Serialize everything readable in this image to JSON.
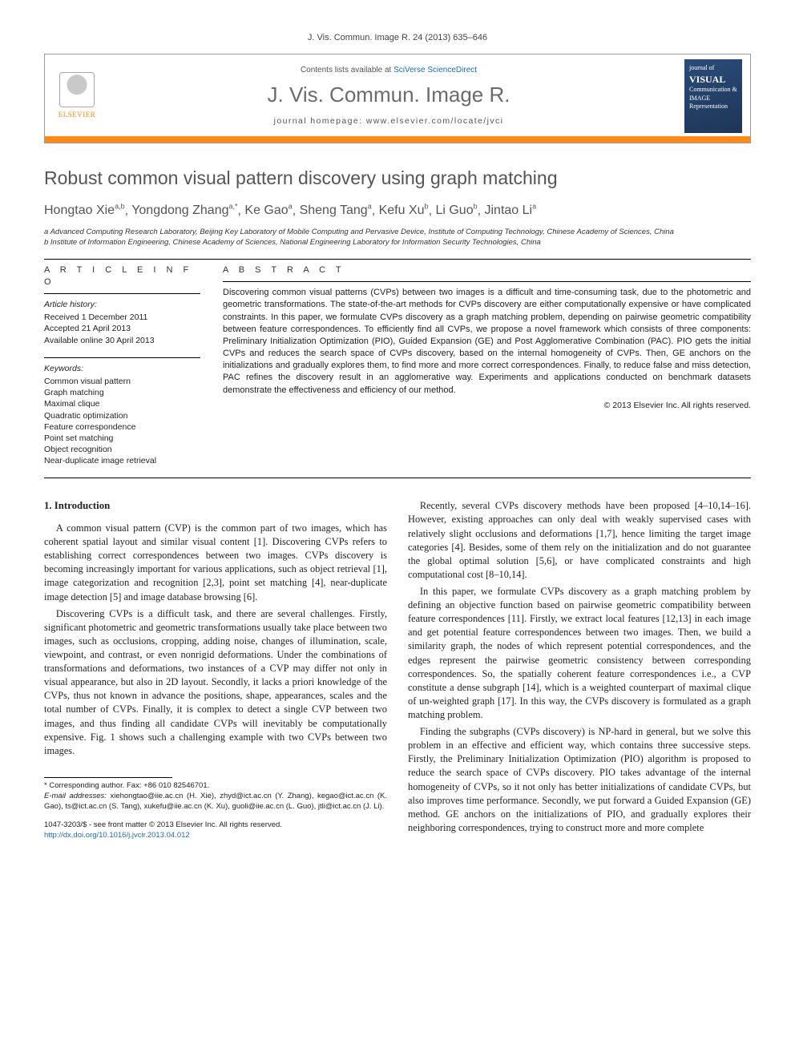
{
  "running_head": "J. Vis. Commun. Image R. 24 (2013) 635–646",
  "header": {
    "contents_prefix": "Contents lists available at ",
    "contents_link": "SciVerse ScienceDirect",
    "journal_title": "J. Vis. Commun. Image R.",
    "homepage_label": "journal homepage: www.elsevier.com/locate/jvci",
    "publisher_name": "ELSEVIER",
    "cover_text_lines": [
      "journal of",
      "VISUAL",
      "Communication & IMAGE",
      "Representation"
    ]
  },
  "article": {
    "title": "Robust common visual pattern discovery using graph matching",
    "authors_html": [
      {
        "name": "Hongtao Xie",
        "aff": "a,b"
      },
      {
        "name": "Yongdong Zhang",
        "aff": "a,*"
      },
      {
        "name": "Ke Gao",
        "aff": "a"
      },
      {
        "name": "Sheng Tang",
        "aff": "a"
      },
      {
        "name": "Kefu Xu",
        "aff": "b"
      },
      {
        "name": "Li Guo",
        "aff": "b"
      },
      {
        "name": "Jintao Li",
        "aff": "a"
      }
    ],
    "affiliations": [
      "a Advanced Computing Research Laboratory, Beijing Key Laboratory of Mobile Computing and Pervasive Device, Institute of Computing Technology, Chinese Academy of Sciences, China",
      "b Institute of Information Engineering, Chinese Academy of Sciences, National Engineering Laboratory for Information Security Technologies, China"
    ]
  },
  "info": {
    "section_label": "A R T I C L E   I N F O",
    "history_label": "Article history:",
    "history": [
      "Received 1 December 2011",
      "Accepted 21 April 2013",
      "Available online 30 April 2013"
    ],
    "keywords_label": "Keywords:",
    "keywords": [
      "Common visual pattern",
      "Graph matching",
      "Maximal clique",
      "Quadratic optimization",
      "Feature correspondence",
      "Point set matching",
      "Object recognition",
      "Near-duplicate image retrieval"
    ]
  },
  "abstract": {
    "section_label": "A B S T R A C T",
    "body": "Discovering common visual patterns (CVPs) between two images is a difficult and time-consuming task, due to the photometric and geometric transformations. The state-of-the-art methods for CVPs discovery are either computationally expensive or have complicated constraints. In this paper, we formulate CVPs discovery as a graph matching problem, depending on pairwise geometric compatibility between feature correspondences. To efficiently find all CVPs, we propose a novel framework which consists of three components: Preliminary Initialization Optimization (PIO), Guided Expansion (GE) and Post Agglomerative Combination (PAC). PIO gets the initial CVPs and reduces the search space of CVPs discovery, based on the internal homogeneity of CVPs. Then, GE anchors on the initializations and gradually explores them, to find more and more correct correspondences. Finally, to reduce false and miss detection, PAC refines the discovery result in an agglomerative way. Experiments and applications conducted on benchmark datasets demonstrate the effectiveness and efficiency of our method.",
    "copyright": "© 2013 Elsevier Inc. All rights reserved."
  },
  "body": {
    "h1": "1. Introduction",
    "paras": [
      "A common visual pattern (CVP) is the common part of two images, which has coherent spatial layout and similar visual content [1]. Discovering CVPs refers to establishing correct correspondences between two images. CVPs discovery is becoming increasingly important for various applications, such as object retrieval [1], image categorization and recognition [2,3], point set matching [4], near-duplicate image detection [5] and image database browsing [6].",
      "Discovering CVPs is a difficult task, and there are several challenges. Firstly, significant photometric and geometric transformations usually take place between two images, such as occlusions, cropping, adding noise, changes of illumination, scale, viewpoint, and contrast, or even nonrigid deformations. Under the combinations of transformations and deformations, two instances of a CVP may differ not only in visual appearance, but also in 2D layout. Secondly, it lacks a priori knowledge of the CVPs, thus not known in advance the positions, shape, appearances, scales and the total number of CVPs. Finally, it is complex to detect a single CVP between two images, and thus finding all candidate CVPs will inevitably be computationally expensive. Fig. 1 shows such a challenging example with two CVPs between two images.",
      "Recently, several CVPs discovery methods have been proposed [4–10,14–16]. However, existing approaches can only deal with weakly supervised cases with relatively slight occlusions and deformations [1,7], hence limiting the target image categories [4]. Besides, some of them rely on the initialization and do not guarantee the global optimal solution [5,6], or have complicated constraints and high computational cost [8–10,14].",
      "In this paper, we formulate CVPs discovery as a graph matching problem by defining an objective function based on pairwise geometric compatibility between feature correspondences [11]. Firstly, we extract local features [12,13] in each image and get potential feature correspondences between two images. Then, we build a similarity graph, the nodes of which represent potential correspondences, and the edges represent the pairwise geometric consistency between corresponding correspondences. So, the spatially coherent feature correspondences i.e., a CVP constitute a dense subgraph [14], which is a weighted counterpart of maximal clique of un-weighted graph [17]. In this way, the CVPs discovery is formulated as a graph matching problem.",
      "Finding the subgraphs (CVPs discovery) is NP-hard in general, but we solve this problem in an effective and efficient way, which contains three successive steps. Firstly, the Preliminary Initialization Optimization (PIO) algorithm is proposed to reduce the search space of CVPs discovery. PIO takes advantage of the internal homogeneity of CVPs, so it not only has better initializations of candidate CVPs, but also improves time performance. Secondly, we put forward a Guided Expansion (GE) method. GE anchors on the initializations of PIO, and gradually explores their neighboring correspondences, trying to construct more and more complete"
    ]
  },
  "footnotes": {
    "corresponding": "* Corresponding author. Fax: +86 010 82546701.",
    "emails_label": "E-mail addresses:",
    "emails": "xiehongtao@iie.ac.cn (H. Xie), zhyd@ict.ac.cn (Y. Zhang), kegao@ict.ac.cn (K. Gao), ts@ict.ac.cn (S. Tang), xukefu@iie.ac.cn (K. Xu), guoli@iie.ac.cn (L. Guo), jtli@ict.ac.cn (J. Li)."
  },
  "copyright": {
    "line1": "1047-3203/$ - see front matter © 2013 Elsevier Inc. All rights reserved.",
    "doi": "http://dx.doi.org/10.1016/j.jvcir.2013.04.012"
  }
}
